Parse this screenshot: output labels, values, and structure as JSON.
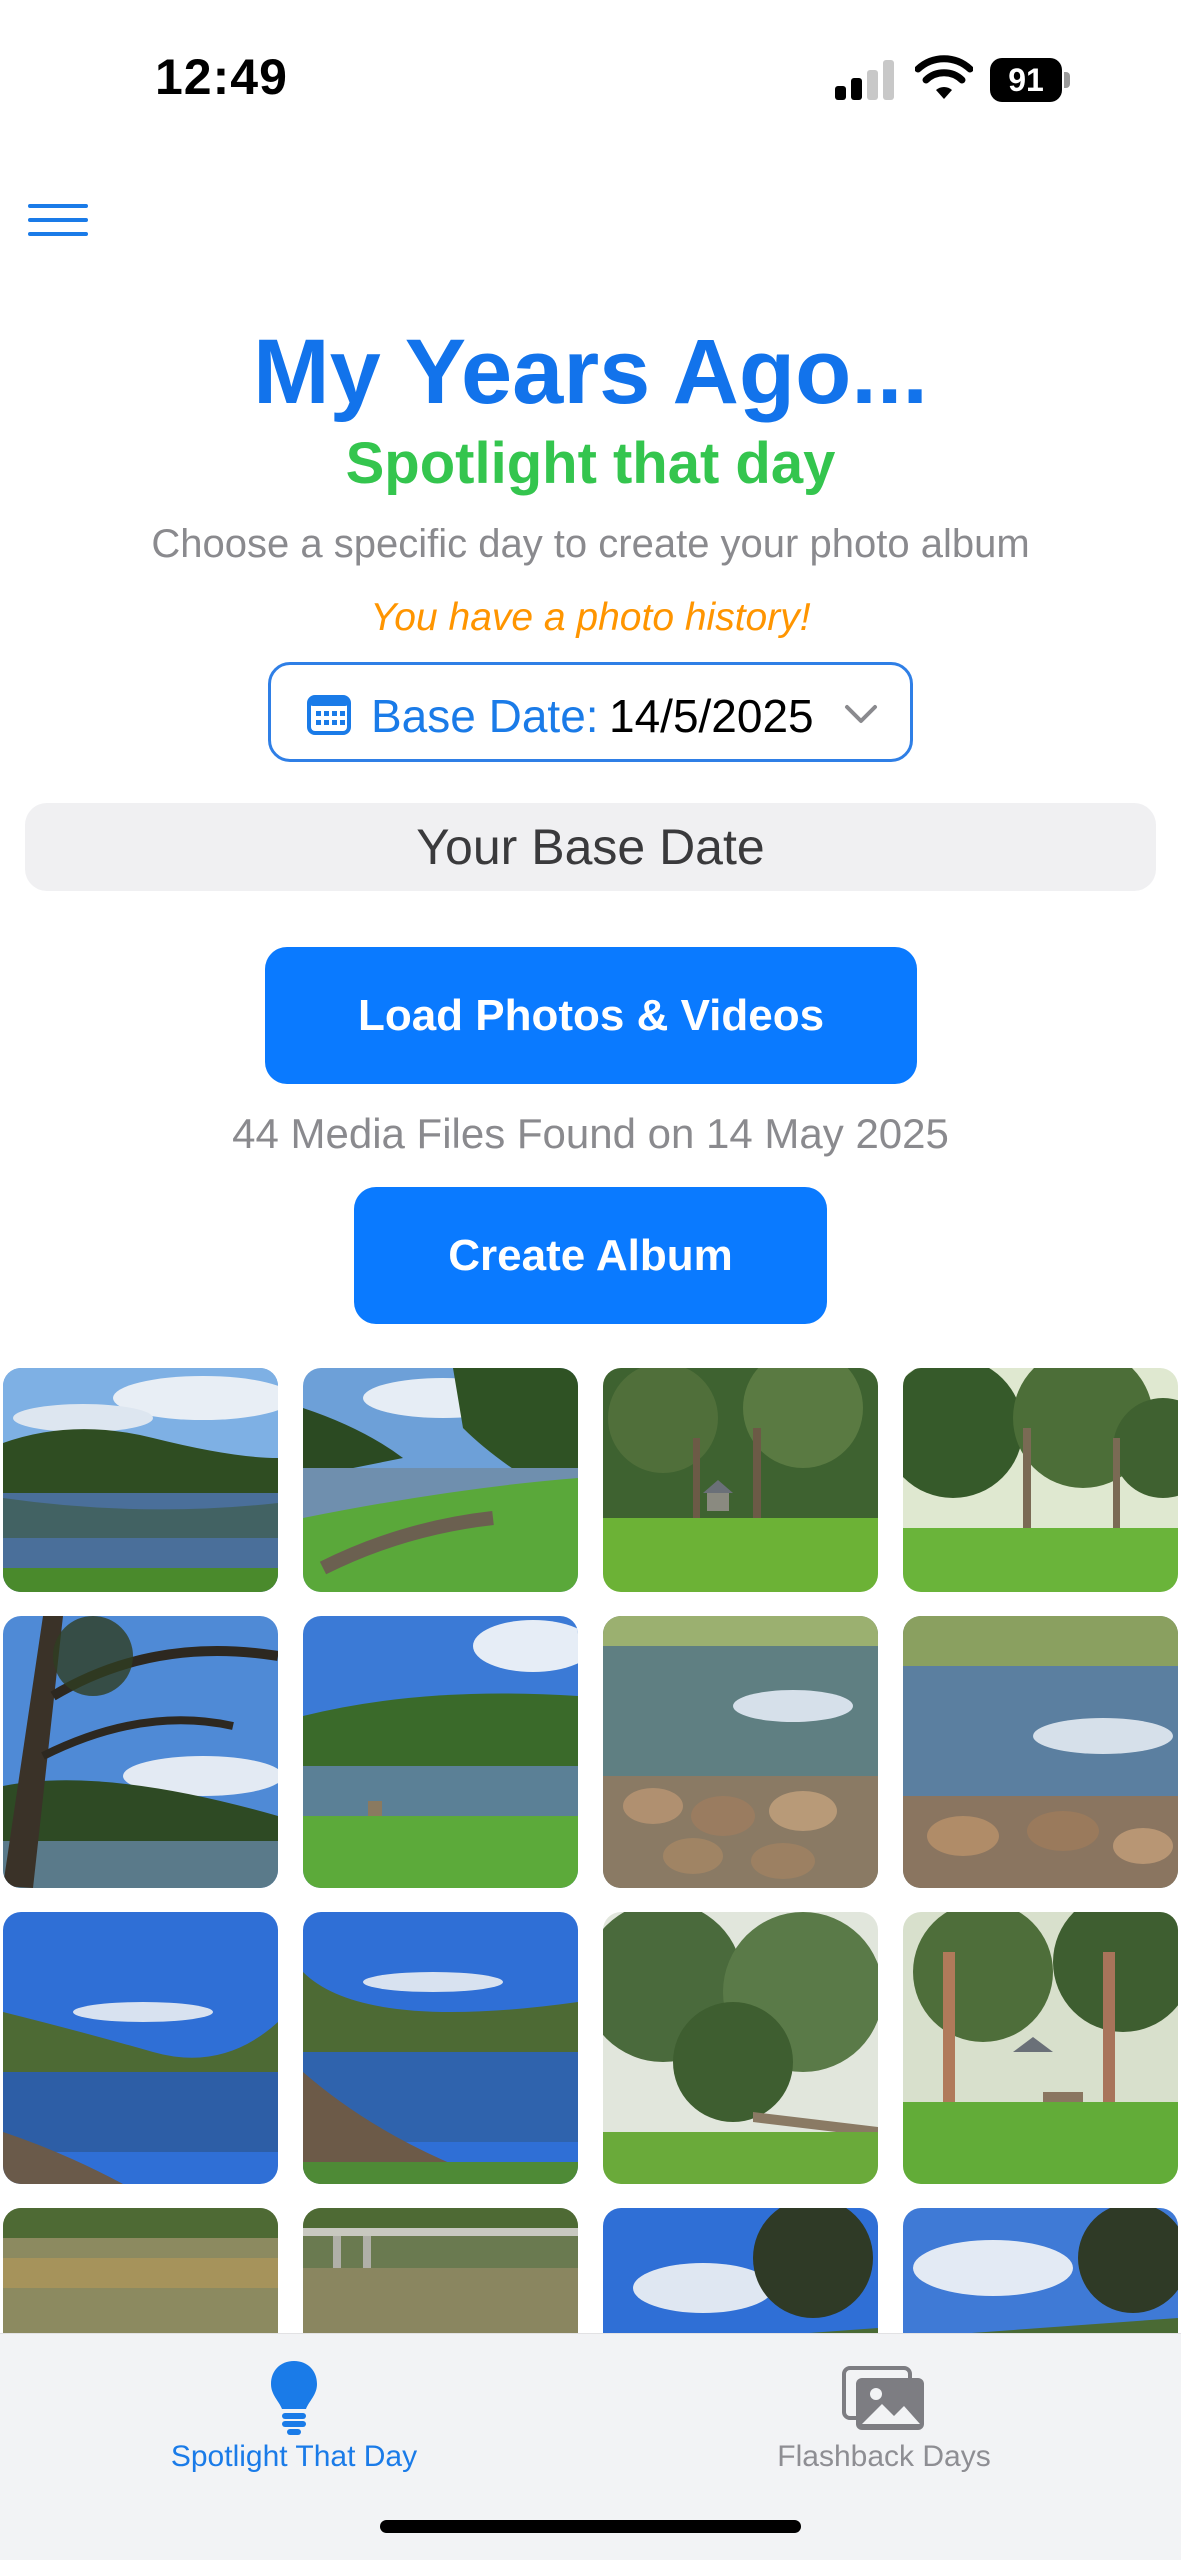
{
  "status_bar": {
    "time": "12:49",
    "battery": "91"
  },
  "header": {
    "menu_icon": "hamburger-menu-icon",
    "title": "My Years Ago...",
    "subtitle": "Spotlight that day",
    "description": "Choose a specific day to create your photo album",
    "history_note": "You have a photo history!"
  },
  "date_picker": {
    "icon": "calendar-icon",
    "label": "Base Date:",
    "value": "14/5/2025",
    "chevron": "chevron-down-icon"
  },
  "base_date_bar": {
    "label": "Your Base Date"
  },
  "actions": {
    "load_label": "Load Photos & Videos",
    "media_count": "44 Media Files Found on 14 May 2025",
    "create_album_label": "Create Album"
  },
  "photos": [
    {
      "scene": "lake-hills-clouds"
    },
    {
      "scene": "lake-shore-grass"
    },
    {
      "scene": "park-gazebo-trees"
    },
    {
      "scene": "park-trees-lawn"
    },
    {
      "scene": "tree-branches-river"
    },
    {
      "scene": "lake-rock-grass"
    },
    {
      "scene": "river-rocks"
    },
    {
      "scene": "river-rocks-2"
    },
    {
      "scene": "blue-lake-reflection"
    },
    {
      "scene": "lake-rocky-shore"
    },
    {
      "scene": "forest-boardwalk"
    },
    {
      "scene": "park-picnic-area"
    },
    {
      "scene": "river-reflection"
    },
    {
      "scene": "bridge-river"
    },
    {
      "scene": "sky-tree-branches"
    },
    {
      "scene": "sky-clouds-tree"
    }
  ],
  "tab_bar": {
    "tabs": [
      {
        "label": "Spotlight That Day",
        "icon": "lightbulb-icon",
        "active": true
      },
      {
        "label": "Flashback Days",
        "icon": "photo-stack-icon",
        "active": false
      }
    ]
  },
  "colors": {
    "accent": "#0a7aff",
    "title_blue": "#1273eb",
    "subtitle_green": "#34c54e",
    "note_orange": "#ff9500",
    "inactive_gray": "#8e8e93"
  }
}
